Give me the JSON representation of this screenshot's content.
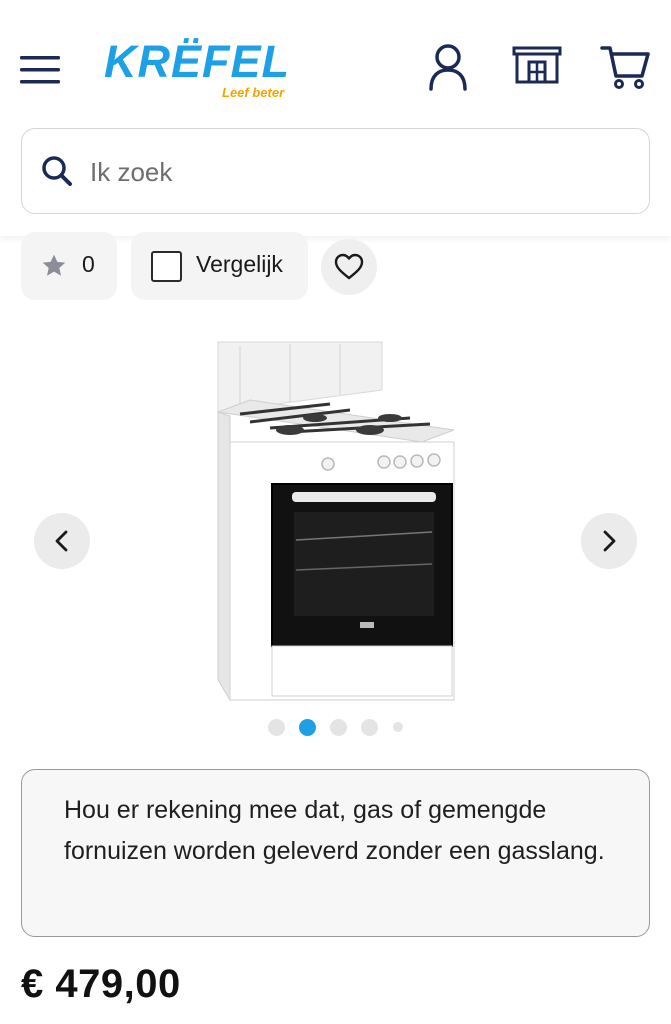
{
  "brand": {
    "name": "KRËFEL",
    "tagline": "Leef beter",
    "primary_color": "#1ea0e6",
    "accent_color": "#f7b500"
  },
  "header": {
    "icons": [
      "menu-icon",
      "account-icon",
      "store-icon",
      "cart-icon"
    ]
  },
  "search": {
    "placeholder": "Ik zoek",
    "value": ""
  },
  "actions": {
    "rating_count": "0",
    "compare_label": "Vergelijk",
    "compare_checked": false
  },
  "gallery": {
    "image_count": 5,
    "active_index": 1
  },
  "notice": {
    "text": "Hou er rekening mee dat, gas of gemengde fornuizen worden geleverd zonder een gasslang."
  },
  "product": {
    "price": "€ 479,00"
  }
}
